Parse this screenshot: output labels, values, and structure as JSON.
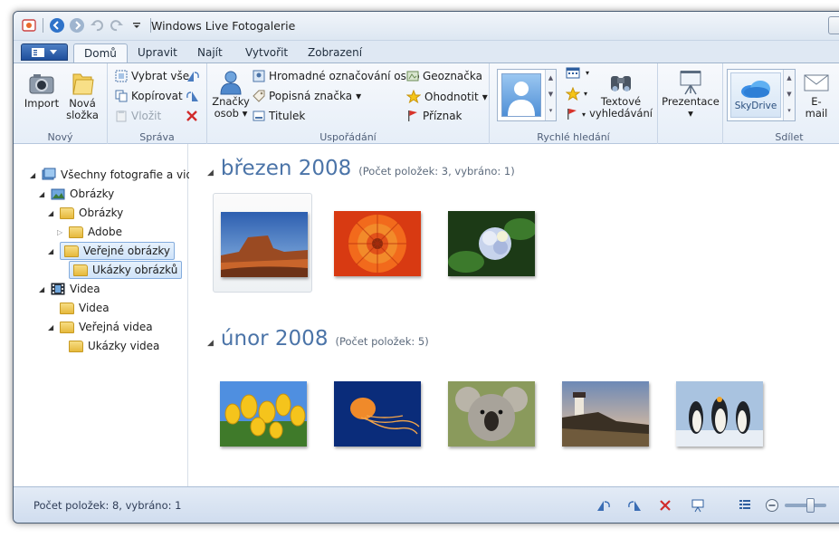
{
  "window": {
    "title": "Windows Live Fotogalerie"
  },
  "tabs": [
    "Domů",
    "Upravit",
    "Najít",
    "Vytvořit",
    "Zobrazení"
  ],
  "ribbon": {
    "novy": {
      "label": "Nový",
      "import": "Import",
      "nova_slozka_1": "Nová",
      "nova_slozka_2": "složka"
    },
    "sprava": {
      "label": "Správa",
      "vybrat_vse": "Vybrat vše",
      "kopirovat": "Kopírovat",
      "vlozit": "Vložit"
    },
    "usporadani": {
      "label": "Uspořádání",
      "znacky_osob_1": "Značky",
      "znacky_osob_2": "osob",
      "hromadne": "Hromadné označování osob",
      "popisna": "Popisná značka",
      "titulek": "Titulek",
      "geoznacka": "Geoznačka",
      "ohodnotit": "Ohodnotit",
      "priznak": "Příznak"
    },
    "rychle_hledani": {
      "label": "Rychlé hledání",
      "textove_1": "Textové",
      "textove_2": "vyhledávání"
    },
    "prezentace": {
      "label": "Prezentace"
    },
    "sdilet": {
      "label": "Sdílet",
      "skydrive": "SkyDrive",
      "email_1": "E-",
      "email_2": "mail"
    }
  },
  "nav": {
    "items": [
      {
        "label": "Všechny fotografie a videa",
        "level": 0
      },
      {
        "label": "Obrázky",
        "level": 1
      },
      {
        "label": "Obrázky",
        "level": 2
      },
      {
        "label": "Adobe",
        "level": 3
      },
      {
        "label": "Veřejné obrázky",
        "level": 2
      },
      {
        "label": "Ukázky obrázků",
        "level": 3
      },
      {
        "label": "Videa",
        "level": 1
      },
      {
        "label": "Videa",
        "level": 2
      },
      {
        "label": "Veřejná videa",
        "level": 2
      },
      {
        "label": "Ukázky videa",
        "level": 3
      }
    ]
  },
  "groups": [
    {
      "title": "březen 2008",
      "count": "(Počet položek: 3, vybráno: 1)",
      "photos": [
        "Desert",
        "Chrysanthemum",
        "Hydrangeas"
      ]
    },
    {
      "title": "únor 2008",
      "count": "(Počet položek: 5)",
      "photos": [
        "Tulips",
        "Jellyfish",
        "Koala",
        "Lighthouse",
        "Penguins"
      ]
    }
  ],
  "status": {
    "text": "Počet položek: 8, vybráno: 1",
    "zoom_level": 0.6
  },
  "colors": {
    "accent": "#4b74a8",
    "ribbon_bg": "#e6eef8",
    "status_bg": "#d8e4f1"
  }
}
